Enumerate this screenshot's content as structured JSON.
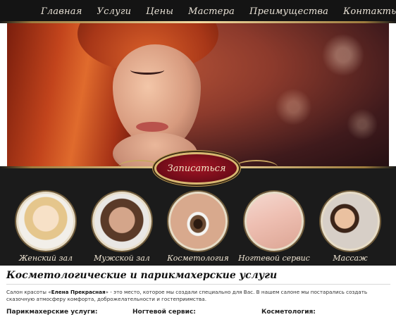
{
  "nav": {
    "items": [
      "Главная",
      "Услуги",
      "Цены",
      "Мастера",
      "Преимущества",
      "Контакты"
    ]
  },
  "cta": {
    "label": "Записаться"
  },
  "services": [
    {
      "label": "Женский зал"
    },
    {
      "label": "Мужской зал"
    },
    {
      "label": "Косметология"
    },
    {
      "label": "Ногтевой сервис"
    },
    {
      "label": "Массаж"
    }
  ],
  "content": {
    "title": "Косметологические и парикмахерские услуги",
    "intro_prefix": "Салон красоты «",
    "intro_name": "Елена Прекрасная",
    "intro_suffix": "» - это место, которое мы создали специально для Вас. В нашем салоне мы постарались создать сказочную атмосферу комфорта, доброжелательности и гостеприимства.",
    "columns": [
      "Парикмахерские услуги:",
      "Ногтевой сервис:",
      "Косметология:"
    ]
  },
  "colors": {
    "nav_bg": "#141414",
    "band_bg": "#1b1b1b",
    "gold": "#d9b872",
    "cta_red": "#8b0f1d"
  }
}
